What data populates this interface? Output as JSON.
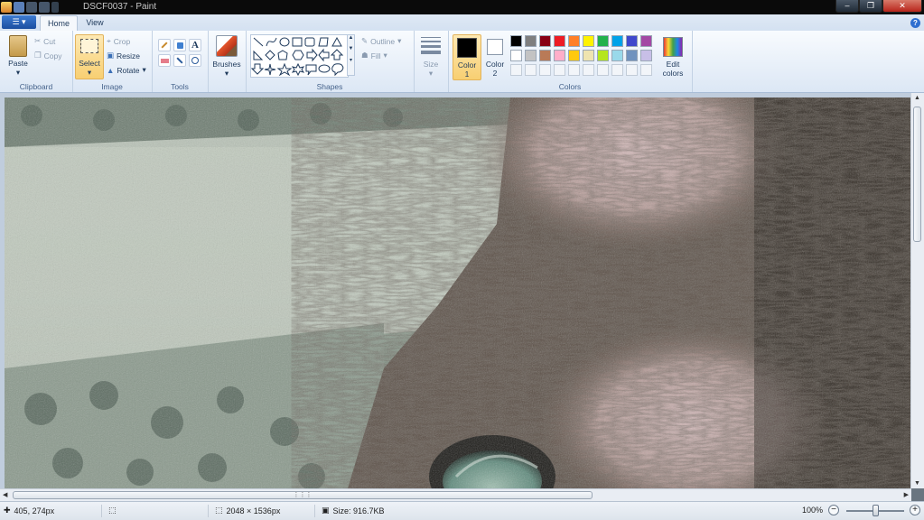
{
  "window": {
    "title": "DSCF0037 - Paint"
  },
  "tabs": [
    {
      "label": "Home"
    },
    {
      "label": "View"
    }
  ],
  "ribbon": {
    "clipboard": {
      "paste": "Paste",
      "cut": "Cut",
      "copy": "Copy",
      "group": "Clipboard"
    },
    "image": {
      "select": "Select",
      "crop": "Crop",
      "resize": "Resize",
      "rotate": "Rotate",
      "group": "Image"
    },
    "tools": {
      "group": "Tools"
    },
    "brushes": {
      "label": "Brushes"
    },
    "shapes": {
      "outline": "Outline",
      "fill": "Fill",
      "group": "Shapes"
    },
    "size": {
      "label": "Size"
    },
    "colors": {
      "color1": "Color 1",
      "color1_line1": "Color",
      "color1_line2": "1",
      "color2_line1": "Color",
      "color2_line2": "2",
      "edit_line1": "Edit",
      "edit_line2": "colors",
      "group": "Colors",
      "color1_value": "#000000",
      "color2_value": "#ffffff",
      "palette_row1": [
        "#000000",
        "#7f7f7f",
        "#880015",
        "#ed1c24",
        "#ff7f27",
        "#fff200",
        "#22b14c",
        "#00a2e8",
        "#3f48cc",
        "#a349a4"
      ],
      "palette_row2": [
        "#ffffff",
        "#c3c3c3",
        "#b97a57",
        "#ffaec9",
        "#ffc90e",
        "#efe4b0",
        "#b5e61d",
        "#99d9ea",
        "#7092be",
        "#c8bfe7"
      ]
    }
  },
  "statusbar": {
    "cursor_pos": "405, 274px",
    "image_dims": "2048 × 1536px",
    "file_size": "Size: 916.7KB",
    "zoom": "100%",
    "zoom_fraction": 0.5
  }
}
